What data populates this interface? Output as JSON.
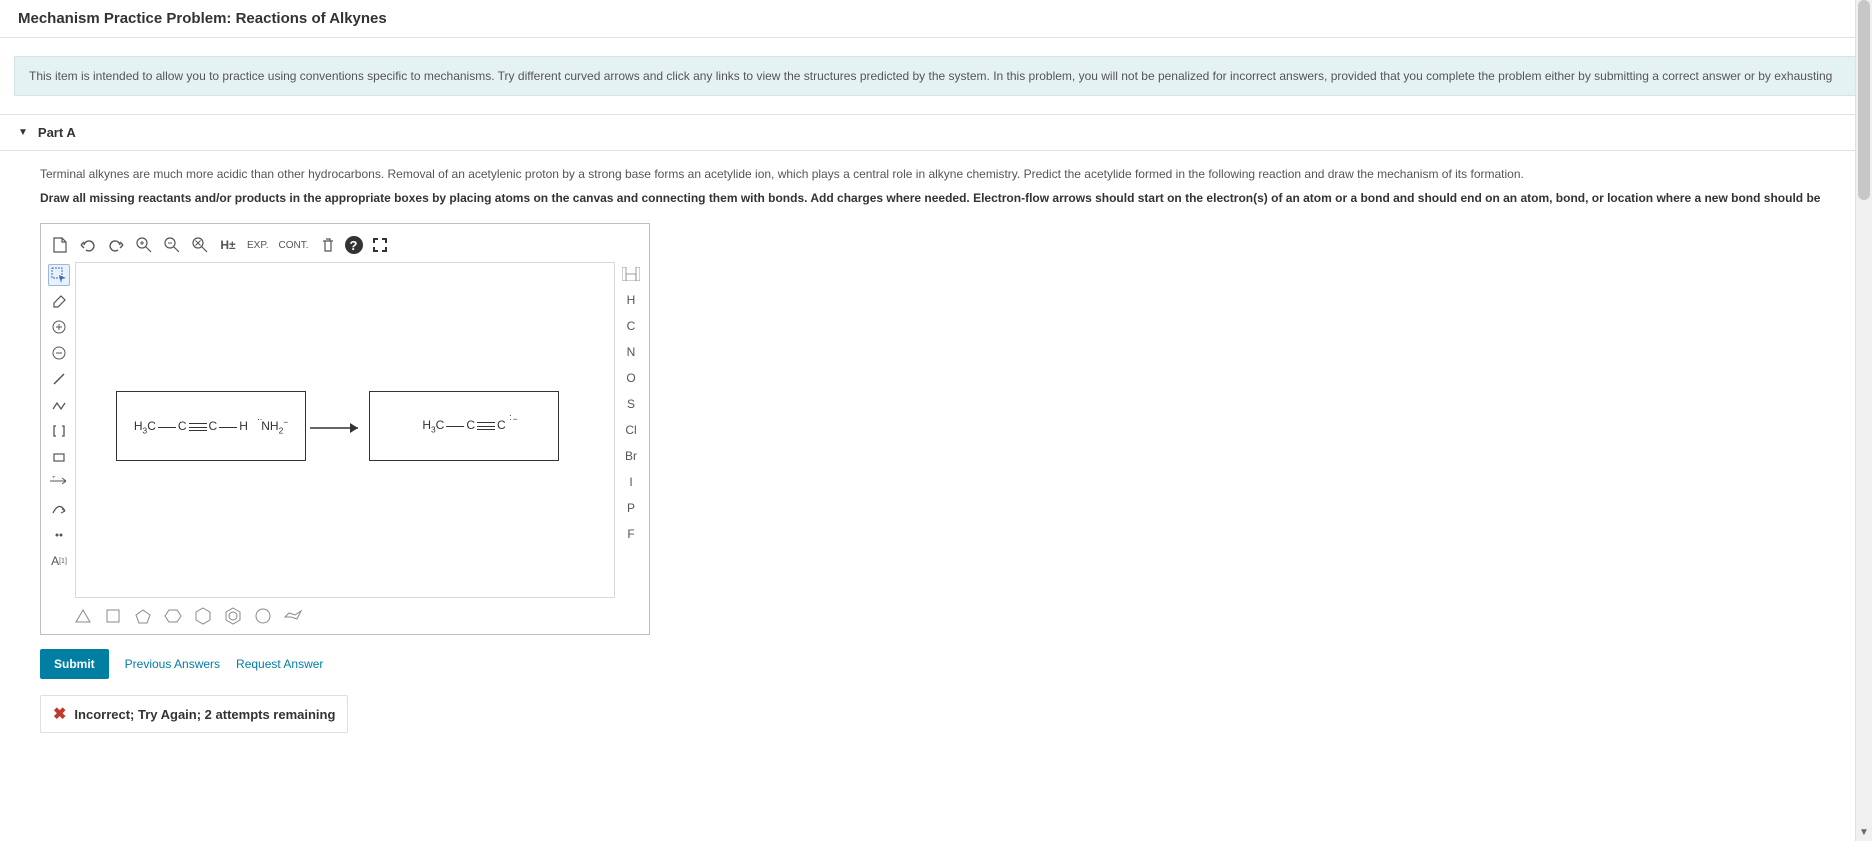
{
  "title": "Mechanism Practice Problem: Reactions of Alkynes",
  "banner": "This item is intended to allow you to practice using conventions specific to mechanisms. Try different curved arrows and click any links to view the structures predicted by the system. In this problem, you will not be penalized for incorrect answers, provided that you complete the problem either by submitting a correct answer or by exhausting",
  "part_label": "Part A",
  "instr1": "Terminal alkynes are much more acidic than other hydrocarbons. Removal of an acetylenic proton by a strong base forms an acetylide ion, which plays a central role in alkyne chemistry. Predict the acetylide formed in the following reaction and draw the mechanism of its formation.",
  "instr2": "Draw all missing reactants and/or products in the appropriate boxes by placing atoms on the canvas and connecting them with bonds. Add charges where needed. Electron-flow arrows should start on the electron(s) of an atom or a bond and should end on an atom, bond, or location where a new bond should be",
  "toolbar_top": {
    "hydrogen_toggle": "H±",
    "exp": "EXP.",
    "cont": "CONT."
  },
  "toolbar_left": {
    "isotope": "A"
  },
  "elements": [
    "H",
    "C",
    "N",
    "O",
    "S",
    "Cl",
    "Br",
    "I",
    "P",
    "F"
  ],
  "reaction": {
    "reactant1": "H₃C—C≡C—H",
    "reagent": ":NH₂⁻",
    "product": "H₃C—C≡C:⁻"
  },
  "buttons": {
    "submit": "Submit",
    "previous": "Previous Answers",
    "request": "Request Answer"
  },
  "feedback": "Incorrect; Try Again; 2 attempts remaining"
}
